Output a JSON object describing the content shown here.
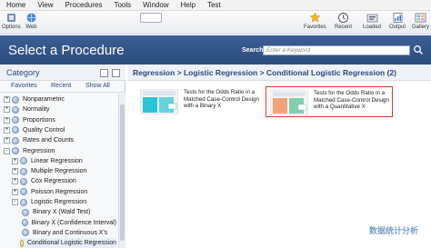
{
  "menubar": {
    "items": [
      "Home",
      "View",
      "Procedures",
      "Tools",
      "Window",
      "Help",
      "Test"
    ]
  },
  "toolbar": {
    "left_items": [
      {
        "label": "Options",
        "icon": "options-icon"
      },
      {
        "label": "Web",
        "icon": "web-icon"
      }
    ],
    "right_items": [
      {
        "label": "Favorites",
        "icon": "star-icon"
      },
      {
        "label": "Recent",
        "icon": "clock-icon"
      },
      {
        "label": "Loaded",
        "icon": "loaded-icon"
      },
      {
        "label": "Output",
        "icon": "output-icon"
      },
      {
        "label": "Gallery",
        "icon": "gallery-icon"
      }
    ]
  },
  "header": {
    "title": "Select a Procedure",
    "search_label": "Search",
    "search_placeholder": "Enter a Keyword"
  },
  "category": {
    "title": "Category",
    "tabs": [
      "Favorites",
      "Recent",
      "Show All"
    ],
    "tree": [
      {
        "label": "Nonparametric",
        "level": 0,
        "expander": "+"
      },
      {
        "label": "Normality",
        "level": 0,
        "expander": "+"
      },
      {
        "label": "Proportions",
        "level": 0,
        "expander": "+"
      },
      {
        "label": "Quality Control",
        "level": 0,
        "expander": "+"
      },
      {
        "label": "Rates and Counts",
        "level": 0,
        "expander": "+"
      },
      {
        "label": "Regression",
        "level": 0,
        "expander": "-"
      },
      {
        "label": "Linear Regression",
        "level": 1,
        "expander": "+"
      },
      {
        "label": "Multiple Regression",
        "level": 1,
        "expander": "+"
      },
      {
        "label": "Cox Regression",
        "level": 1,
        "expander": "+"
      },
      {
        "label": "Poisson Regression",
        "level": 1,
        "expander": "+"
      },
      {
        "label": "Logistic Regression",
        "level": 1,
        "expander": "-"
      },
      {
        "label": "Binary X (Wald Test)",
        "level": 2,
        "expander": ""
      },
      {
        "label": "Binary X (Confidence Interval)",
        "level": 2,
        "expander": ""
      },
      {
        "label": "Binary and Continuous X's",
        "level": 2,
        "expander": ""
      },
      {
        "label": "Conditional Logistic Regression",
        "level": 2,
        "expander": "",
        "selected": true
      }
    ]
  },
  "breadcrumb": {
    "text": "Regression > Logistic Regression > Conditional Logistic Regression (2)"
  },
  "procedures": [
    {
      "text": "Tests for the Odds Ratio in a Matched Case-Control Design with a Binary X",
      "selected": false
    },
    {
      "text": "Tests for the Odds Ratio in a Matched Case-Control Design with a Quantitative X",
      "selected": true
    }
  ],
  "watermark": "数据统计分析",
  "colors": {
    "header_bg": "#2f5288",
    "selection_border": "#e0392b",
    "link_blue": "#2a4a7a"
  }
}
